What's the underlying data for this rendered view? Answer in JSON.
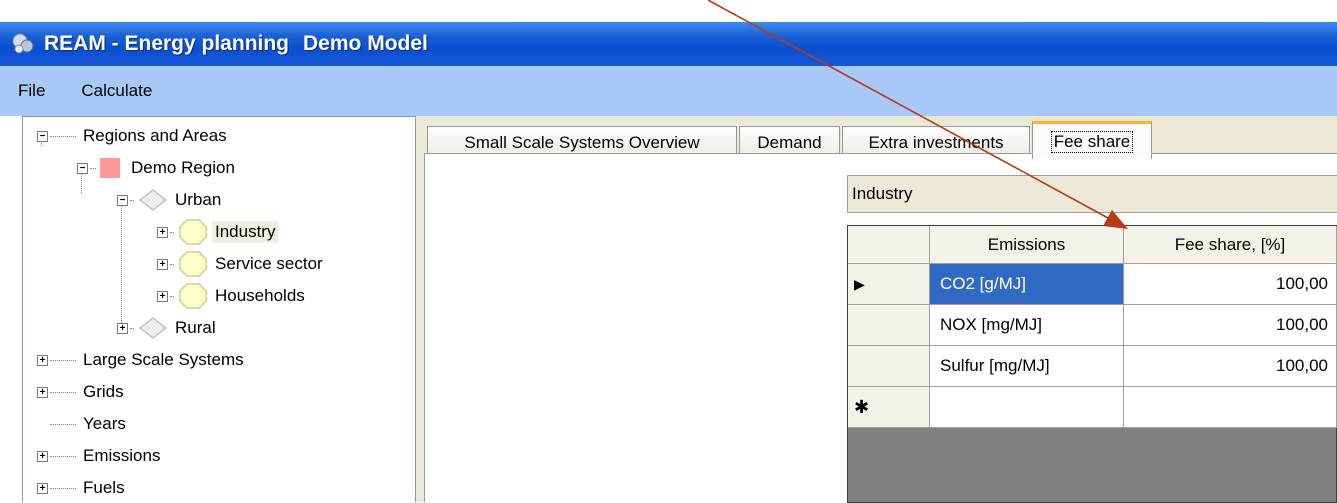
{
  "window": {
    "title": "REAM - Energy planning",
    "model_name": "Demo Model"
  },
  "menu": [
    "File",
    "Calculate"
  ],
  "tree": {
    "regions": "Regions and Areas",
    "demo_region": "Demo Region",
    "urban": "Urban",
    "industry": "Industry",
    "service": "Service sector",
    "households": "Households",
    "rural": "Rural",
    "large_scale": "Large Scale Systems",
    "grids": "Grids",
    "years": "Years",
    "emissions": "Emissions",
    "fuels": "Fuels"
  },
  "tabs": [
    "Small Scale Systems Overview",
    "Demand",
    "Extra investments",
    "Fee share"
  ],
  "active_tab": "Fee share",
  "group_title": "Industry",
  "grid": {
    "columns": [
      "Emissions",
      "Fee share, [%]"
    ],
    "rows": [
      {
        "emission": "CO2  [g/MJ]",
        "share": "100,00"
      },
      {
        "emission": "NOX  [mg/MJ]",
        "share": "100,00"
      },
      {
        "emission": "Sulfur  [mg/MJ]",
        "share": "100,00"
      }
    ],
    "current_row_marker": "▶",
    "new_row_marker": "✱"
  },
  "colors": {
    "title_bar": "#0a4fd0",
    "menu_bar": "#a8c8f8",
    "selection": "#316ac5",
    "annotation_arrow": "#b83a16"
  }
}
